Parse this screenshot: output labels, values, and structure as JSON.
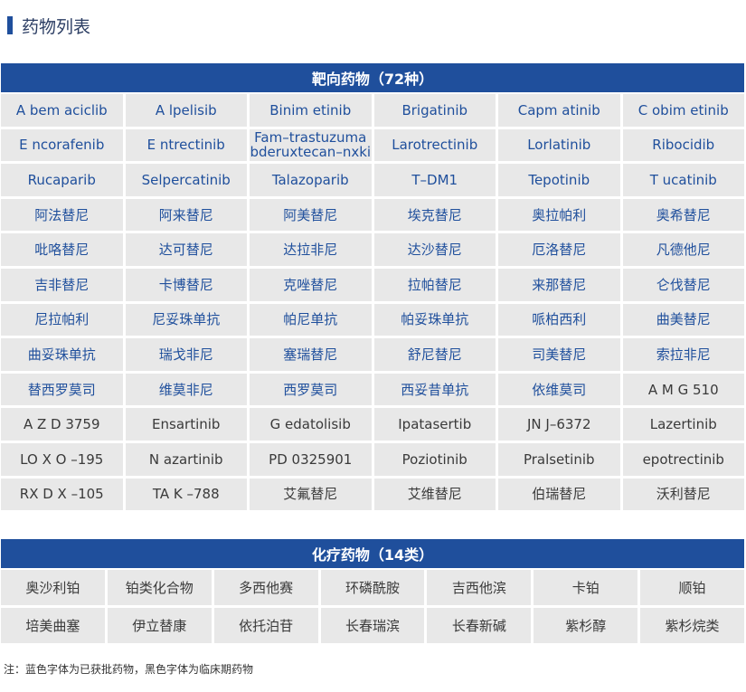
{
  "title": "药物列表",
  "targeted": {
    "header": "靶向药物（72种）",
    "rows": [
      [
        {
          "t": "A bem aciclib",
          "c": false
        },
        {
          "t": "A lpelisib",
          "c": false
        },
        {
          "t": "Binim etinib",
          "c": false
        },
        {
          "t": "Brigatinib",
          "c": false
        },
        {
          "t": "Capm atinib",
          "c": false
        },
        {
          "t": "C obim etinib",
          "c": false
        }
      ],
      [
        {
          "t": "E ncorafenib",
          "c": false
        },
        {
          "t": "E ntrectinib",
          "c": false
        },
        {
          "t": "Fam–trastuzuma bderuxtecan–nxki",
          "c": false
        },
        {
          "t": "Larotrectinib",
          "c": false
        },
        {
          "t": "Lorlatinib",
          "c": false
        },
        {
          "t": "Ribocidib",
          "c": false
        }
      ],
      [
        {
          "t": "Rucaparib",
          "c": false
        },
        {
          "t": "Selpercatinib",
          "c": false
        },
        {
          "t": "Talazoparib",
          "c": false
        },
        {
          "t": "T–DM1",
          "c": false
        },
        {
          "t": "Tepotinib",
          "c": false
        },
        {
          "t": "T ucatinib",
          "c": false
        }
      ],
      [
        {
          "t": "阿法替尼",
          "c": false
        },
        {
          "t": "阿来替尼",
          "c": false
        },
        {
          "t": "阿美替尼",
          "c": false
        },
        {
          "t": "埃克替尼",
          "c": false
        },
        {
          "t": "奥拉帕利",
          "c": false
        },
        {
          "t": "奥希替尼",
          "c": false
        }
      ],
      [
        {
          "t": "吡咯替尼",
          "c": false
        },
        {
          "t": "达可替尼",
          "c": false
        },
        {
          "t": "达拉非尼",
          "c": false
        },
        {
          "t": "达沙替尼",
          "c": false
        },
        {
          "t": "厄洛替尼",
          "c": false
        },
        {
          "t": "凡德他尼",
          "c": false
        }
      ],
      [
        {
          "t": "吉非替尼",
          "c": false
        },
        {
          "t": "卡博替尼",
          "c": false
        },
        {
          "t": "克唑替尼",
          "c": false
        },
        {
          "t": "拉帕替尼",
          "c": false
        },
        {
          "t": "来那替尼",
          "c": false
        },
        {
          "t": "仑伐替尼",
          "c": false
        }
      ],
      [
        {
          "t": "尼拉帕利",
          "c": false
        },
        {
          "t": "尼妥珠单抗",
          "c": false
        },
        {
          "t": "帕尼单抗",
          "c": false
        },
        {
          "t": "帕妥珠单抗",
          "c": false
        },
        {
          "t": "哌柏西利",
          "c": false
        },
        {
          "t": "曲美替尼",
          "c": false
        }
      ],
      [
        {
          "t": "曲妥珠单抗",
          "c": false
        },
        {
          "t": "瑞戈非尼",
          "c": false
        },
        {
          "t": "塞瑞替尼",
          "c": false
        },
        {
          "t": "舒尼替尼",
          "c": false
        },
        {
          "t": "司美替尼",
          "c": false
        },
        {
          "t": "索拉非尼",
          "c": false
        }
      ],
      [
        {
          "t": "替西罗莫司",
          "c": false
        },
        {
          "t": "维莫非尼",
          "c": false
        },
        {
          "t": "西罗莫司",
          "c": false
        },
        {
          "t": "西妥昔单抗",
          "c": false
        },
        {
          "t": "依维莫司",
          "c": false
        },
        {
          "t": "A M G 510",
          "c": true
        }
      ],
      [
        {
          "t": "A Z D 3759",
          "c": true
        },
        {
          "t": "Ensartinib",
          "c": true
        },
        {
          "t": "G edatolisib",
          "c": true
        },
        {
          "t": "Ipatasertib",
          "c": true
        },
        {
          "t": "JN J–6372",
          "c": true
        },
        {
          "t": "Lazertinib",
          "c": true
        }
      ],
      [
        {
          "t": "LO X O –195",
          "c": true
        },
        {
          "t": "N azartinib",
          "c": true
        },
        {
          "t": "PD 0325901",
          "c": true
        },
        {
          "t": "Poziotinib",
          "c": true
        },
        {
          "t": "Pralsetinib",
          "c": true
        },
        {
          "t": "epotrectinib",
          "c": true
        }
      ],
      [
        {
          "t": "RX D X –105",
          "c": true
        },
        {
          "t": "TA K –788",
          "c": true
        },
        {
          "t": "艾氟替尼",
          "c": true
        },
        {
          "t": "艾维替尼",
          "c": true
        },
        {
          "t": "伯瑞替尼",
          "c": true
        },
        {
          "t": "沃利替尼",
          "c": true
        }
      ]
    ]
  },
  "chemo": {
    "header": "化疗药物（14类）",
    "rows": [
      [
        "奥沙利铂",
        "铂类化合物",
        "多西他赛",
        "环磷酰胺",
        "吉西他滨",
        "卡铂",
        "顺铂"
      ],
      [
        "培美曲塞",
        "伊立替康",
        "依托泊苷",
        "长春瑞滨",
        "长春新碱",
        "紫杉醇",
        "紫杉烷类"
      ]
    ]
  },
  "note": "注：蓝色字体为已获批药物，黑色字体为临床期药物"
}
